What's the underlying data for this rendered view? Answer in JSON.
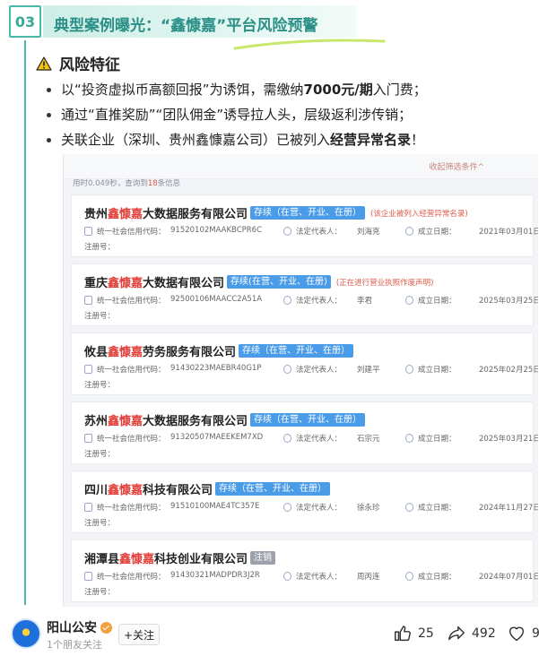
{
  "header": {
    "number": "03",
    "title": "典型案例曝光：“鑫慷嘉”平台风险预警"
  },
  "risk": {
    "title": "风险特征",
    "bullets": [
      {
        "pre": "以“投资虚拟币高额回报”为诱饵，需缴纳",
        "bold": "7000元/期",
        "post": "入门费；"
      },
      {
        "pre": "通过“直推奖励”“团队佣金”诱导拉人头，层级返利涉传销；",
        "bold": "",
        "post": ""
      },
      {
        "pre": "关联企业（深圳、贵州鑫慷嘉公司）已被列入",
        "bold": "经营异常名录",
        "post": "！"
      }
    ]
  },
  "search_panel": {
    "filter_link": "收起筛选条件^",
    "stat_pre": "用时0.049秒，查询到",
    "stat_count": "18",
    "stat_post": "条信息",
    "credit_label": "统一社会信用代码：",
    "rep_label": "法定代表人：",
    "date_label": "成立日期：",
    "reg_label": "注册号：",
    "companies": [
      {
        "pre": "贵州",
        "hl": "鑫慷嘉",
        "post": "大数据服务有限公司",
        "status": "存续（在营、开业、在册）",
        "status_type": "blue",
        "note": "(该企业被列入经营异常名录)",
        "code": "91520102MAAKBCPR6C",
        "rep": "刘海克",
        "date": "2021年03月01日"
      },
      {
        "pre": "重庆",
        "hl": "鑫慷嘉",
        "post": "大数据有限公司",
        "status": "存续(在营、开业、在册)",
        "status_type": "blue",
        "note": "(正在进行营业执照作废声明)",
        "code": "92500106MAACC2A51A",
        "rep": "李君",
        "date": "2025年03月25日"
      },
      {
        "pre": "攸县",
        "hl": "鑫慷嘉",
        "post": "劳务服务有限公司",
        "status": "存续（在营、开业、在册）",
        "status_type": "blue",
        "note": "",
        "code": "91430223MAEBR40G1P",
        "rep": "刘建平",
        "date": "2025年02月25日"
      },
      {
        "pre": "苏州",
        "hl": "鑫慷嘉",
        "post": "大数据服务有限公司",
        "status": "存续（在营、开业、在册）",
        "status_type": "blue",
        "note": "",
        "code": "91320507MAEEKEM7XD",
        "rep": "石宗元",
        "date": "2025年03月21日"
      },
      {
        "pre": "四川",
        "hl": "鑫慷嘉",
        "post": "科技有限公司",
        "status": "存续（在营、开业、在册）",
        "status_type": "blue",
        "note": "",
        "code": "91510100MAE4TC357E",
        "rep": "徐永珍",
        "date": "2024年11月27日"
      },
      {
        "pre": "湘潭县",
        "hl": "鑫慷嘉",
        "post": "科技创业有限公司",
        "status": "注销",
        "status_type": "gray",
        "note": "",
        "code": "91430321MADPDR3J2R",
        "rep": "周丙连",
        "date": "2024年07月01日"
      }
    ]
  },
  "footer": {
    "account_name": "阳山公安",
    "account_sub": "1个朋友关注",
    "follow_label": "+关注",
    "likes": "25",
    "shares": "492",
    "favorites": "9",
    "colors": {
      "accent": "#49b9a8",
      "highlight": "#e0413b",
      "tag": "#4a9be8"
    }
  }
}
